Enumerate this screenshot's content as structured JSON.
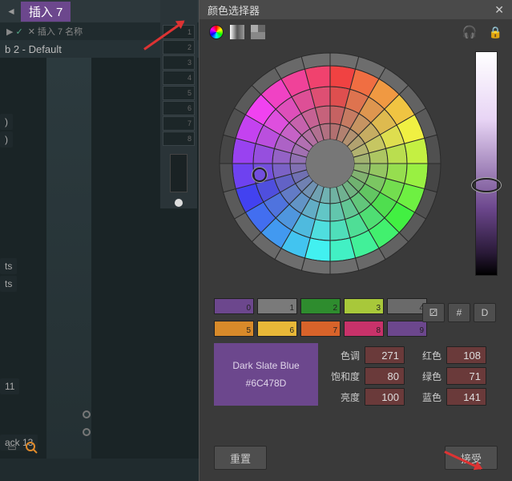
{
  "left": {
    "tab_name": "插入 7",
    "sub_text": "插入 7 名称",
    "preset": "b 2 - Default",
    "side_items": [
      ")",
      ")",
      "ts",
      "ts",
      "11",
      "ack 13"
    ]
  },
  "mixer": {
    "slots": [
      "1",
      "2",
      "3",
      "4",
      "5",
      "6",
      "7",
      "8"
    ]
  },
  "picker": {
    "title": "颜色选择器",
    "palette1": [
      {
        "c": "#6c478d",
        "n": "0"
      },
      {
        "c": "#7a7a7a",
        "n": "1"
      },
      {
        "c": "#2e8c2e",
        "n": "2"
      },
      {
        "c": "#a8c83a",
        "n": "3"
      },
      {
        "c": "#6a6a6a",
        "n": "4"
      }
    ],
    "palette2": [
      {
        "c": "#d88a2a",
        "n": "5"
      },
      {
        "c": "#e8b838",
        "n": "6"
      },
      {
        "c": "#d8632a",
        "n": "7"
      },
      {
        "c": "#c8326a",
        "n": "8"
      },
      {
        "c": "#6c478d",
        "n": "9"
      }
    ],
    "modes": [
      "⚂",
      "#",
      "D"
    ],
    "preview_name": "Dark Slate Blue",
    "preview_hex": "#6C478D",
    "hsl_labels": {
      "h": "色调",
      "s": "饱和度",
      "l": "亮度"
    },
    "rgb_labels": {
      "r": "红色",
      "g": "绿色",
      "b": "蓝色"
    },
    "hsl": {
      "h": "271",
      "s": "80",
      "l": "100"
    },
    "rgb": {
      "r": "108",
      "g": "71",
      "b": "141"
    },
    "reset": "重置",
    "accept": "接受"
  }
}
